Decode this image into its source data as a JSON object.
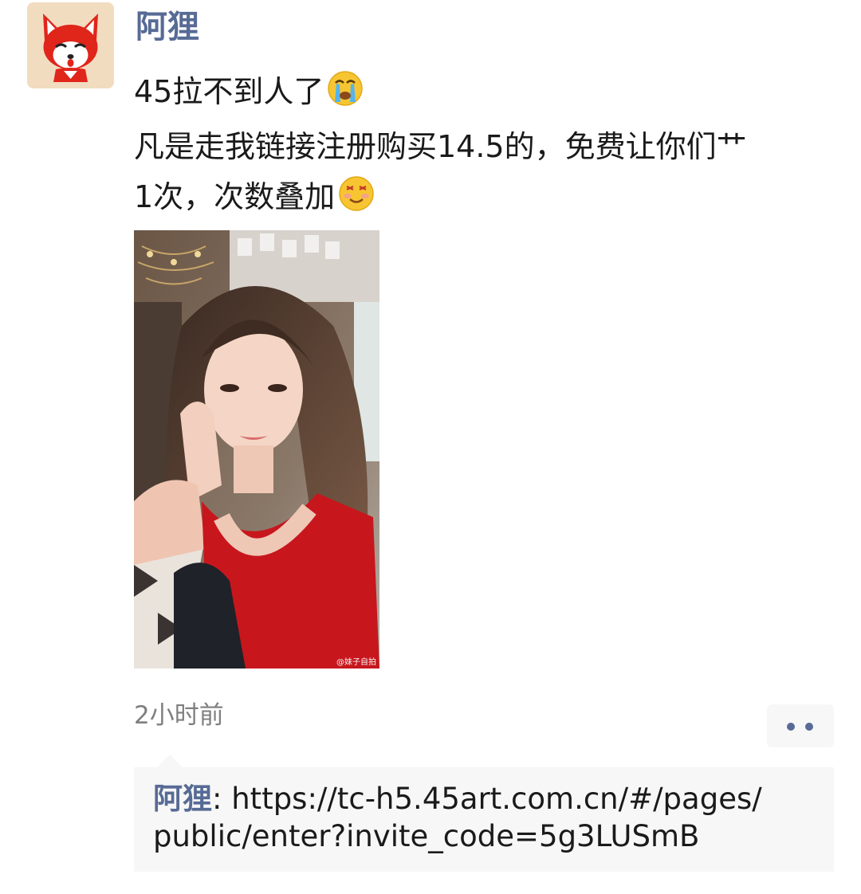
{
  "post": {
    "author": "阿狸",
    "text_line1": "45拉不到人了",
    "text_line2": "凡是走我链接注册购买14.5的，免费让你们艹",
    "text_line3": "1次，次数叠加",
    "timestamp": "2小时前",
    "photo_watermark": "@妹子自拍"
  },
  "comment": {
    "author": "阿狸",
    "separator": ": ",
    "text": "https://tc-h5.45art.com.cn/#/pages/public/enter?invite_code=5g3LUSmB"
  },
  "icons": {
    "avatar": "fox-avatar-icon",
    "emoji1": "crying-face-icon",
    "emoji2": "smirking-face-icon",
    "more": "more-dots-icon"
  },
  "colors": {
    "link": "#576b95",
    "comment_bg": "#f7f7f7",
    "timestamp": "#7f7f7f"
  }
}
